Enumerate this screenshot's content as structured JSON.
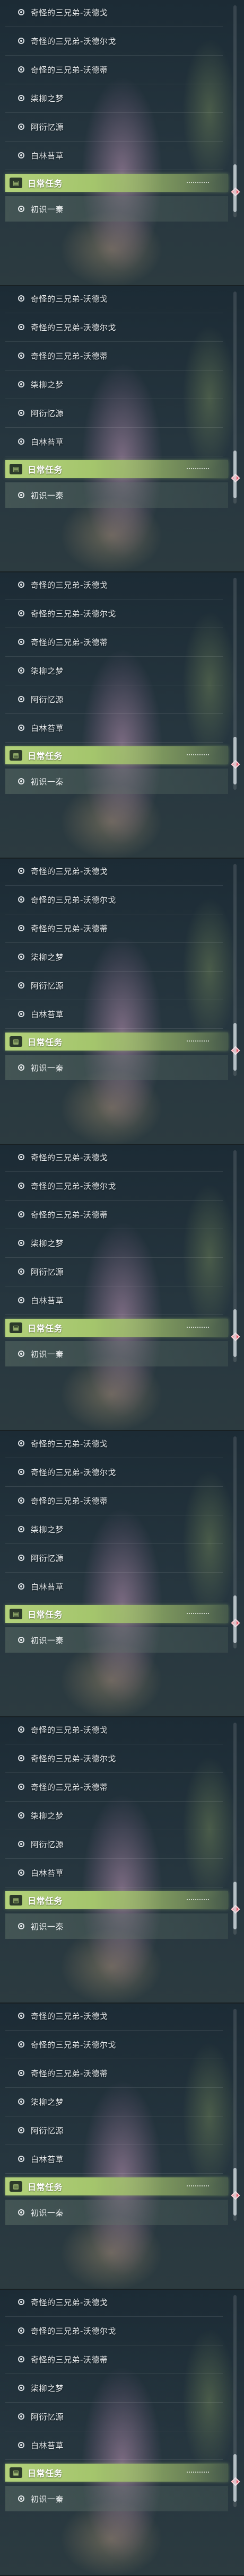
{
  "quest_list": {
    "items": [
      {
        "label": "奇怪的三兄弟-沃德戈"
      },
      {
        "label": "奇怪的三兄弟-沃德尔戈"
      },
      {
        "label": "奇怪的三兄弟-沃德蒂"
      },
      {
        "label": "柒柳之梦"
      },
      {
        "label": "阿衍忆源"
      },
      {
        "label": "白林苔草"
      }
    ],
    "daily_header": "日常任务",
    "daily_task_icon": "task-book-icon",
    "daily_sub_item": "初识一秦",
    "badge_color": "#e24e5f",
    "accent_color": "#b2d17a"
  },
  "panel_count": 9
}
